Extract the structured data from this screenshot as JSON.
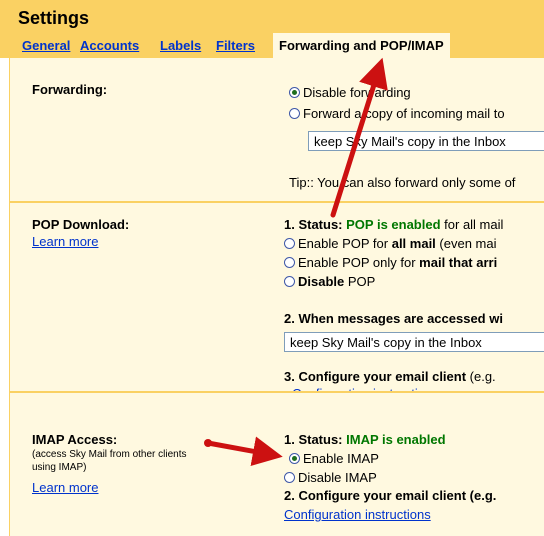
{
  "header": {
    "title": "Settings",
    "tabs": [
      {
        "label": "General",
        "active": false
      },
      {
        "label": "Accounts",
        "active": false
      },
      {
        "label": "Labels",
        "active": false
      },
      {
        "label": "Filters",
        "active": false
      },
      {
        "label": "Forwarding and POP/IMAP",
        "active": true
      }
    ]
  },
  "forwarding": {
    "label": "Forwarding:",
    "disable_option": "Disable forwarding",
    "forward_option": "Forward a copy of incoming mail to",
    "keep_select": "keep Sky Mail's copy in the Inbox",
    "tip": "Tip:: You can also forward only some of"
  },
  "pop": {
    "label": "POP Download:",
    "learn_more": "Learn more",
    "status_prefix": "1. Status: ",
    "status_value": "POP is enabled",
    "status_suffix": " for all mail",
    "opt1_a": "Enable POP for ",
    "opt1_b": "all mail",
    "opt1_c": " (even mai",
    "opt2_a": "Enable POP only for ",
    "opt2_b": "mail that arri",
    "opt3_a": "Disable",
    "opt3_b": " POP",
    "step2": "2. When messages are accessed wi",
    "keep_select": "keep Sky Mail's copy in the Inbox",
    "step3_a": "3. Configure your email client",
    "step3_b": " (e.g. ",
    "config_link": "Configuration instructions"
  },
  "imap": {
    "label": "IMAP Access:",
    "sub": "(access Sky Mail from other clients using IMAP)",
    "learn_more": "Learn more",
    "status_prefix": "1. Status: ",
    "status_value": "IMAP is enabled",
    "enable": "Enable IMAP",
    "disable": "Disable IMAP",
    "step2": "2. Configure your email client (e.g.",
    "config_link": "Configuration instructions"
  },
  "colors": {
    "header_bg": "#fad163",
    "section_bg": "#fff9e0",
    "link": "#0033cc",
    "status_green": "#007700",
    "arrow": "#cc1111"
  }
}
